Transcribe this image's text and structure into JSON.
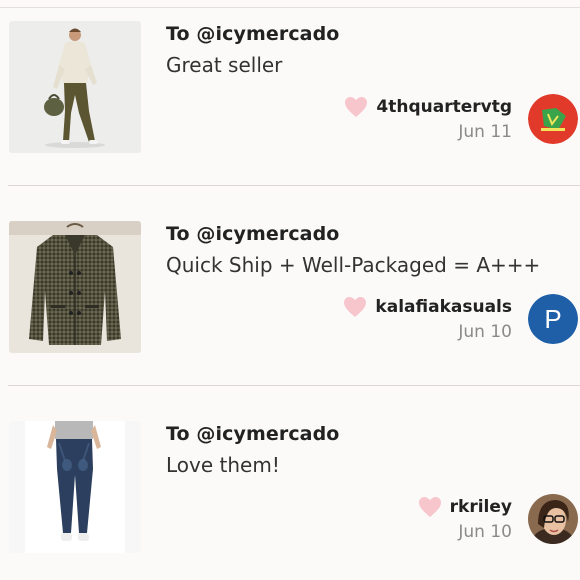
{
  "reviews": [
    {
      "to": "To @icymercado",
      "comment": "Great seller",
      "username": "4thquartervtg",
      "date": "Jun 11",
      "product": "man-in-sweater-and-trousers",
      "avatar": "red-logo"
    },
    {
      "to": "To @icymercado",
      "comment": "Quick Ship + Well-Packaged = A+++",
      "username": "kalafiakasuals",
      "date": "Jun 10",
      "product": "houndstooth-jacket",
      "avatar": "letter",
      "avatar_letter": "P"
    },
    {
      "to": "To @icymercado",
      "comment": "Love them!",
      "username": "rkriley",
      "date": "Jun 10",
      "product": "skinny-jeans",
      "avatar": "photo"
    }
  ],
  "colors": {
    "heart": "#f7c6cc",
    "avatar_blue": "#1e5fa8",
    "avatar_red": "#e23a2a",
    "date_gray": "#8a8a8a"
  },
  "icons": [
    "heart-icon"
  ]
}
